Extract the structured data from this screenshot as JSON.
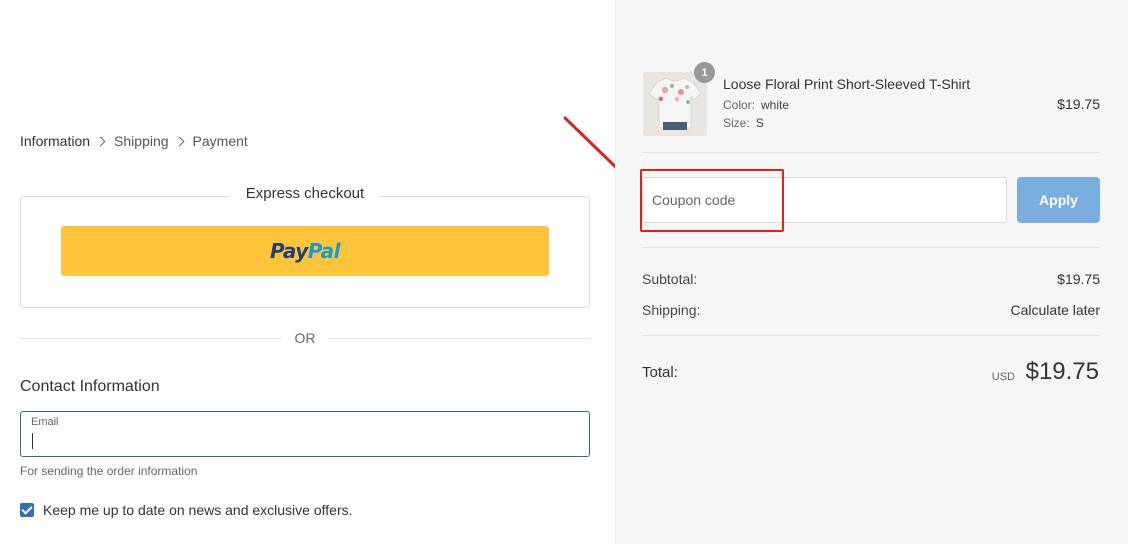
{
  "breadcrumb": {
    "items": [
      "Information",
      "Shipping",
      "Payment"
    ]
  },
  "express": {
    "title": "Express checkout",
    "paypal_part1": "Pay",
    "paypal_part2": "Pal"
  },
  "divider_text": "OR",
  "contact": {
    "title": "Contact Information",
    "email_label": "Email",
    "email_value": "",
    "email_hint": "For sending the order information",
    "newsletter_label": "Keep me up to date on news and exclusive offers.",
    "newsletter_checked": true
  },
  "cart": {
    "product": {
      "name": "Loose Floral Print Short-Sleeved T-Shirt",
      "color_key": "Color:",
      "color_value": "white",
      "size_key": "Size:",
      "size_value": "S",
      "price": "$19.75",
      "quantity": "1"
    },
    "coupon": {
      "placeholder": "Coupon code",
      "apply_label": "Apply"
    },
    "summary": {
      "subtotal_label": "Subtotal:",
      "subtotal_value": "$19.75",
      "shipping_label": "Shipping:",
      "shipping_value": "Calculate later"
    },
    "total": {
      "label": "Total:",
      "currency": "USD",
      "amount": "$19.75"
    }
  },
  "colors": {
    "paypal_yellow": "#ffc439",
    "apply_blue": "#7aaee0",
    "annotation_red": "#e0201a",
    "checkbox_blue": "#2f6fb4",
    "input_focus_border": "#2a6e95"
  },
  "icons": [
    "chevron-right-icon",
    "checkmark-icon",
    "annotation-arrow-icon"
  ]
}
